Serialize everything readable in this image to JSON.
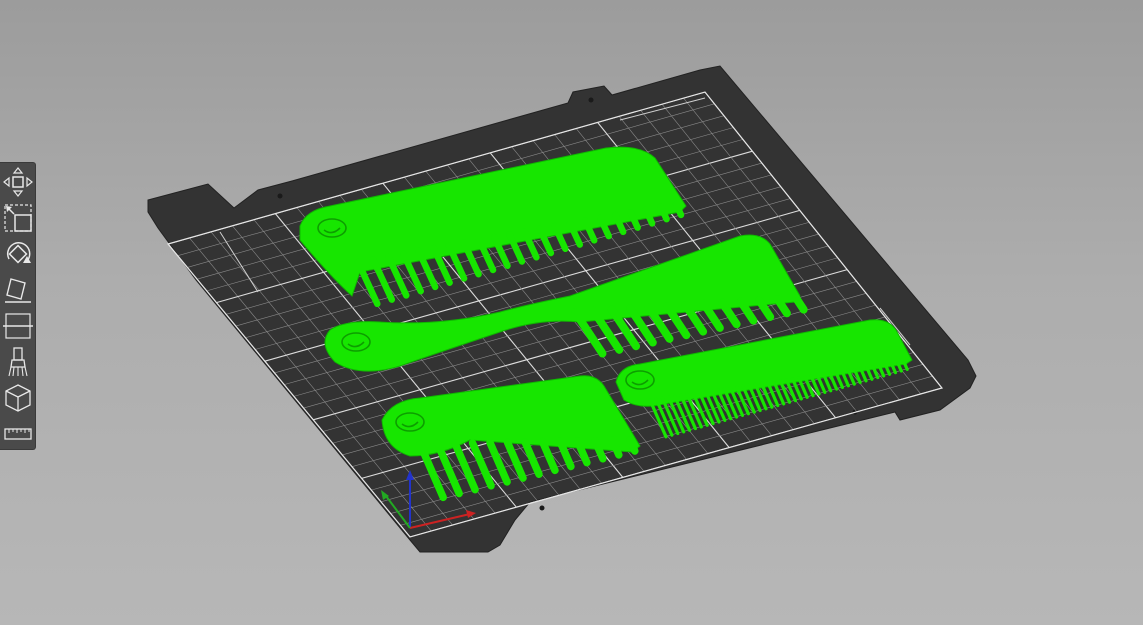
{
  "app": {
    "view": "3D plater"
  },
  "colors": {
    "background_top": "#9c9c9c",
    "background_bottom": "#b7b7b7",
    "bed_sheet": "#333333",
    "bed_grid": "#d8d8d8",
    "model_green": "#17e600",
    "axis_x": "#cc2222",
    "axis_y": "#22aa22",
    "axis_z": "#2233cc",
    "toolbar": "#4a4a4a"
  },
  "toolbar": {
    "tools": [
      {
        "name": "move-tool",
        "icon": "move-icon"
      },
      {
        "name": "scale-tool",
        "icon": "scale-icon"
      },
      {
        "name": "rotate-tool",
        "icon": "rotate-icon"
      },
      {
        "name": "place-on-face-tool",
        "icon": "place-on-face-icon"
      },
      {
        "name": "cut-tool",
        "icon": "cut-icon"
      },
      {
        "name": "paint-supports-tool",
        "icon": "paint-brush-icon"
      },
      {
        "name": "seam-painting-tool",
        "icon": "seam-cube-icon"
      },
      {
        "name": "measure-tool",
        "icon": "ruler-icon"
      }
    ]
  },
  "objects": [
    {
      "name": "comb-top",
      "teeth": 22
    },
    {
      "name": "comb-middle",
      "teeth": 13
    },
    {
      "name": "comb-bottom-left",
      "teeth": 13
    },
    {
      "name": "comb-bottom-right",
      "teeth": 42
    }
  ]
}
